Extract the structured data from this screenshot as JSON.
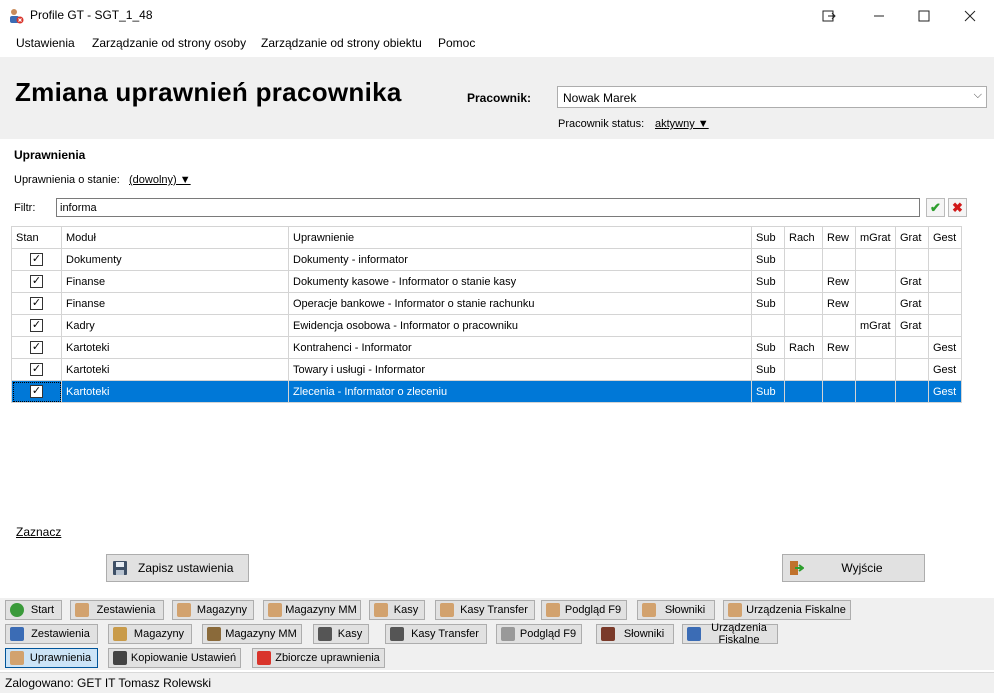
{
  "window": {
    "title": "Profile GT - SGT_1_48"
  },
  "menu": [
    "Ustawienia",
    "Zarządzanie od strony osoby",
    "Zarządzanie od strony obiektu",
    "Pomoc"
  ],
  "header": {
    "title": "Zmiana uprawnień pracownika",
    "pracownik_label": "Pracownik:",
    "pracownik_value": "Nowak Marek",
    "status_label": "Pracownik status:",
    "status_value": "aktywny ▼"
  },
  "uprawnienia": {
    "section_title": "Uprawnienia",
    "state_label": "Uprawnienia o stanie:",
    "state_value": "(dowolny) ▼",
    "filter_label": "Filtr:",
    "filter_value": "informa"
  },
  "table": {
    "columns": [
      "Stan",
      "Moduł",
      "Uprawnienie",
      "Sub",
      "Rach",
      "Rew",
      "mGrat",
      "Grat",
      "Gest"
    ],
    "rows": [
      {
        "checked": true,
        "cells": [
          "Dokumenty",
          "Dokumenty - informator",
          "Sub",
          "",
          "",
          "",
          "",
          ""
        ]
      },
      {
        "checked": true,
        "cells": [
          "Finanse",
          "Dokumenty kasowe - Informator o stanie kasy",
          "Sub",
          "",
          "Rew",
          "",
          "Grat",
          ""
        ]
      },
      {
        "checked": true,
        "cells": [
          "Finanse",
          "Operacje bankowe - Informator o stanie rachunku",
          "Sub",
          "",
          "Rew",
          "",
          "Grat",
          ""
        ]
      },
      {
        "checked": true,
        "cells": [
          "Kadry",
          "Ewidencja osobowa - Informator o pracowniku",
          "",
          "",
          "",
          "mGrat",
          "Grat",
          ""
        ]
      },
      {
        "checked": true,
        "cells": [
          "Kartoteki",
          "Kontrahenci - Informator",
          "Sub",
          "Rach",
          "Rew",
          "",
          "",
          "Gest"
        ]
      },
      {
        "checked": true,
        "cells": [
          "Kartoteki",
          "Towary i usługi - Informator",
          "Sub",
          "",
          "",
          "",
          "",
          "Gest"
        ]
      },
      {
        "checked": true,
        "selected": true,
        "cells": [
          "Kartoteki",
          "Zlecenia - Informator o zleceniu",
          "Sub",
          "",
          "",
          "",
          "",
          "Gest"
        ]
      }
    ]
  },
  "actions": {
    "zaznacz": "Zaznacz",
    "save": "Zapisz ustawienia",
    "exit": "Wyjście"
  },
  "toolbar1": [
    "Start",
    "Zestawienia",
    "Magazyny",
    "Magazyny MM",
    "Kasy",
    "Kasy Transfer",
    "Podgląd F9",
    "Słowniki",
    "Urządzenia Fiskalne"
  ],
  "toolbar2": [
    "Zestawienia",
    "Magazyny",
    "Magazyny MM",
    "Kasy",
    "Kasy Transfer",
    "Podgląd F9",
    "Słowniki",
    "Urządzenia Fiskalne"
  ],
  "toolbar3": [
    "Uprawnienia",
    "Kopiowanie Ustawień",
    "Zbiorcze uprawnienia"
  ],
  "status": "Zalogowano: GET IT Tomasz Rolewski"
}
